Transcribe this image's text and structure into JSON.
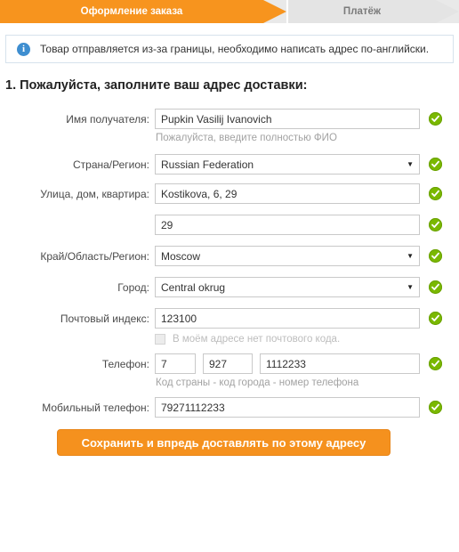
{
  "steps": [
    {
      "label": "Оформление заказа",
      "state": "active"
    },
    {
      "label": "Платёж",
      "state": "inactive"
    }
  ],
  "notice": {
    "icon": "info-icon",
    "text": "Товар отправляется из-за границы, необходимо написать адрес по-английски."
  },
  "section": {
    "title": "1. Пожалуйста, заполните ваш адрес доставки:"
  },
  "fields": {
    "recipient": {
      "label": "Имя получателя:",
      "value": "Pupkin Vasilij Ivanovich",
      "helper": "Пожалуйста, введите полностью ФИО"
    },
    "country": {
      "label": "Страна/Регион:",
      "value": "Russian Federation"
    },
    "street": {
      "label": "Улица, дом, квартира:",
      "value": "Kostikova, 6, 29"
    },
    "street2": {
      "label": "",
      "value": "29"
    },
    "region": {
      "label": "Край/Область/Регион:",
      "value": "Moscow"
    },
    "city": {
      "label": "Город:",
      "value": "Central okrug"
    },
    "postcode": {
      "label": "Почтовый индекс:",
      "value": "123100",
      "checkbox_label": "В моём адресе нет почтового кода."
    },
    "phone": {
      "label": "Телефон:",
      "country_code": "7",
      "area_code": "927",
      "number": "1112233",
      "helper": "Код страны - код города - номер телефона"
    },
    "mobile": {
      "label": "Мобильный телефон:",
      "value": "79271112233"
    }
  },
  "submit": {
    "label": "Сохранить и впредь доставлять по этому адресу"
  },
  "colors": {
    "accent_orange": "#f5911e",
    "step_active": "#f7941e",
    "step_inactive": "#e4e4e4",
    "valid_green": "#7ab800",
    "info_blue": "#3e8ed0"
  }
}
